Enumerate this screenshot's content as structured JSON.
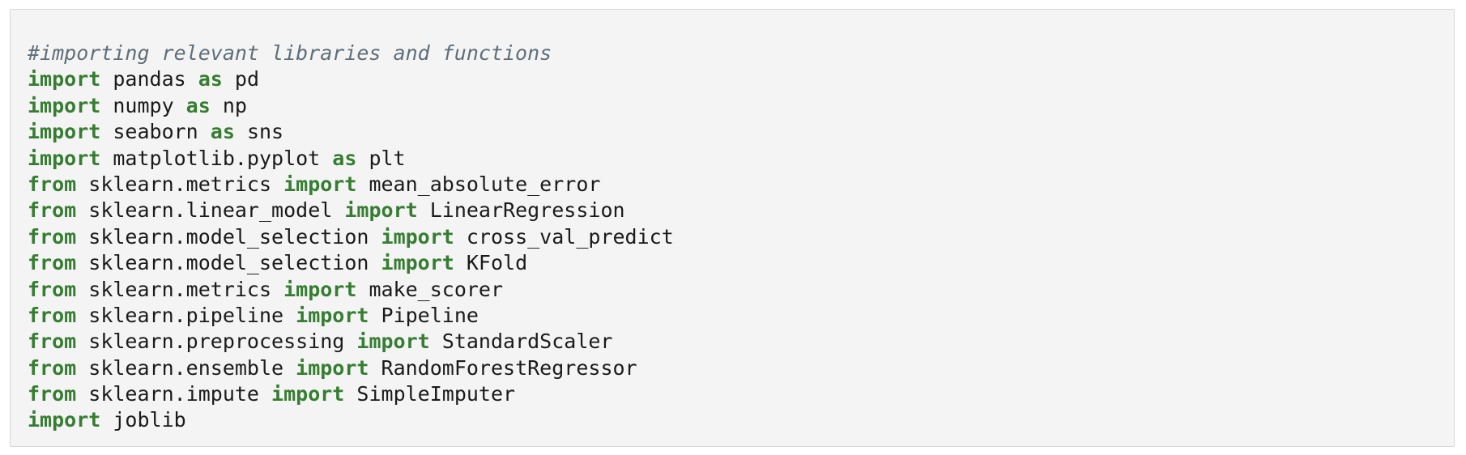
{
  "colors": {
    "background": "#f4f4f4",
    "border": "#d8d8d8",
    "keyword": "#367d32",
    "comment": "#5e6e7a",
    "text": "#1a1a1a"
  },
  "code": {
    "lines": [
      [
        {
          "t": "comment",
          "v": "#importing relevant libraries and functions"
        }
      ],
      [
        {
          "t": "kw",
          "v": "import"
        },
        {
          "t": "plain",
          "v": " pandas "
        },
        {
          "t": "kw",
          "v": "as"
        },
        {
          "t": "plain",
          "v": " pd"
        }
      ],
      [
        {
          "t": "kw",
          "v": "import"
        },
        {
          "t": "plain",
          "v": " numpy "
        },
        {
          "t": "kw",
          "v": "as"
        },
        {
          "t": "plain",
          "v": " np"
        }
      ],
      [
        {
          "t": "kw",
          "v": "import"
        },
        {
          "t": "plain",
          "v": " seaborn "
        },
        {
          "t": "kw",
          "v": "as"
        },
        {
          "t": "plain",
          "v": " sns"
        }
      ],
      [
        {
          "t": "kw",
          "v": "import"
        },
        {
          "t": "plain",
          "v": " matplotlib.pyplot "
        },
        {
          "t": "kw",
          "v": "as"
        },
        {
          "t": "plain",
          "v": " plt"
        }
      ],
      [
        {
          "t": "kw",
          "v": "from"
        },
        {
          "t": "plain",
          "v": " sklearn.metrics "
        },
        {
          "t": "kw",
          "v": "import"
        },
        {
          "t": "plain",
          "v": " mean_absolute_error"
        }
      ],
      [
        {
          "t": "kw",
          "v": "from"
        },
        {
          "t": "plain",
          "v": " sklearn.linear_model "
        },
        {
          "t": "kw",
          "v": "import"
        },
        {
          "t": "plain",
          "v": " LinearRegression"
        }
      ],
      [
        {
          "t": "kw",
          "v": "from"
        },
        {
          "t": "plain",
          "v": " sklearn.model_selection "
        },
        {
          "t": "kw",
          "v": "import"
        },
        {
          "t": "plain",
          "v": " cross_val_predict"
        }
      ],
      [
        {
          "t": "kw",
          "v": "from"
        },
        {
          "t": "plain",
          "v": " sklearn.model_selection "
        },
        {
          "t": "kw",
          "v": "import"
        },
        {
          "t": "plain",
          "v": " KFold"
        }
      ],
      [
        {
          "t": "kw",
          "v": "from"
        },
        {
          "t": "plain",
          "v": " sklearn.metrics "
        },
        {
          "t": "kw",
          "v": "import"
        },
        {
          "t": "plain",
          "v": " make_scorer"
        }
      ],
      [
        {
          "t": "kw",
          "v": "from"
        },
        {
          "t": "plain",
          "v": " sklearn.pipeline "
        },
        {
          "t": "kw",
          "v": "import"
        },
        {
          "t": "plain",
          "v": " Pipeline"
        }
      ],
      [
        {
          "t": "kw",
          "v": "from"
        },
        {
          "t": "plain",
          "v": " sklearn.preprocessing "
        },
        {
          "t": "kw",
          "v": "import"
        },
        {
          "t": "plain",
          "v": " StandardScaler"
        }
      ],
      [
        {
          "t": "kw",
          "v": "from"
        },
        {
          "t": "plain",
          "v": " sklearn.ensemble "
        },
        {
          "t": "kw",
          "v": "import"
        },
        {
          "t": "plain",
          "v": " RandomForestRegressor"
        }
      ],
      [
        {
          "t": "kw",
          "v": "from"
        },
        {
          "t": "plain",
          "v": " sklearn.impute "
        },
        {
          "t": "kw",
          "v": "import"
        },
        {
          "t": "plain",
          "v": " SimpleImputer"
        }
      ],
      [
        {
          "t": "kw",
          "v": "import"
        },
        {
          "t": "plain",
          "v": " joblib"
        }
      ]
    ]
  }
}
